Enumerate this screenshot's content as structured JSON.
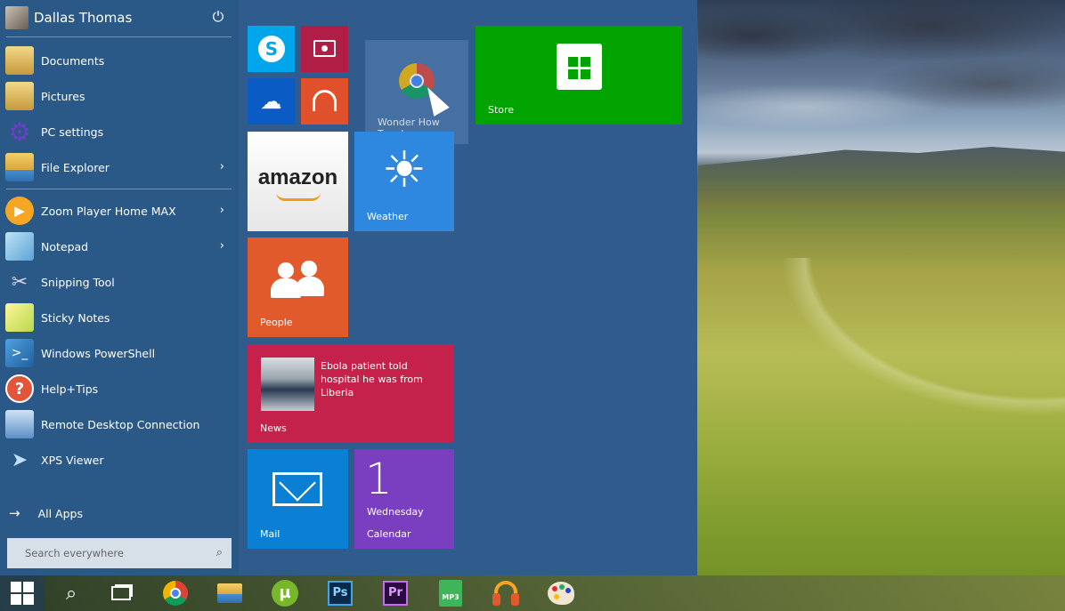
{
  "user": {
    "name": "Dallas Thomas"
  },
  "menu": {
    "pinned": [
      {
        "label": "Documents",
        "icon": "documents-folder-icon"
      },
      {
        "label": "Pictures",
        "icon": "pictures-folder-icon"
      },
      {
        "label": "PC settings",
        "icon": "gear-icon"
      },
      {
        "label": "File Explorer",
        "icon": "file-explorer-icon",
        "chevron": "›"
      }
    ],
    "apps": [
      {
        "label": "Zoom Player Home MAX",
        "icon": "zoom-player-icon",
        "chevron": "›"
      },
      {
        "label": "Notepad",
        "icon": "notepad-icon",
        "chevron": "›"
      },
      {
        "label": "Snipping Tool",
        "icon": "scissors-icon"
      },
      {
        "label": "Sticky Notes",
        "icon": "sticky-notes-icon"
      },
      {
        "label": "Windows PowerShell",
        "icon": "powershell-icon"
      },
      {
        "label": "Help+Tips",
        "icon": "help-icon"
      },
      {
        "label": "Remote Desktop Connection",
        "icon": "remote-desktop-icon"
      },
      {
        "label": "XPS Viewer",
        "icon": "xps-viewer-icon"
      }
    ],
    "all_apps": "All Apps"
  },
  "search": {
    "placeholder": "Search everywhere"
  },
  "tiles": {
    "store": "Store",
    "amazon": "amazon",
    "weather": "Weather",
    "people": "People",
    "news": {
      "label": "News",
      "headline": "Ebola patient told hospital he was from Liberia"
    },
    "mail": "Mail",
    "calendar": {
      "label": "Calendar",
      "day_number": "1",
      "day_name": "Wednesday"
    },
    "dragging": {
      "label": "Wonder How To.url"
    }
  },
  "colors": {
    "start_bg": "#2f5c8c",
    "skype": "#00a5ec",
    "video": "#b01e45",
    "onedrive": "#0a5bc4",
    "music": "#e0502a",
    "store": "#00a300",
    "weather": "#2f88e0",
    "people": "#e05a2b",
    "news": "#c4224b",
    "mail": "#0a7fd4",
    "calendar": "#7a3ec0"
  },
  "taskbar": [
    "windows-start-icon",
    "search-icon",
    "task-view-icon",
    "chrome-icon",
    "file-explorer-icon",
    "utorrent-icon",
    "photoshop-icon",
    "premiere-icon",
    "mp3-file-icon",
    "headphones-app-icon",
    "paint-palette-icon"
  ],
  "taskbar_text": {
    "ps": "Ps",
    "pr": "Pr",
    "mp3": "MP3"
  }
}
